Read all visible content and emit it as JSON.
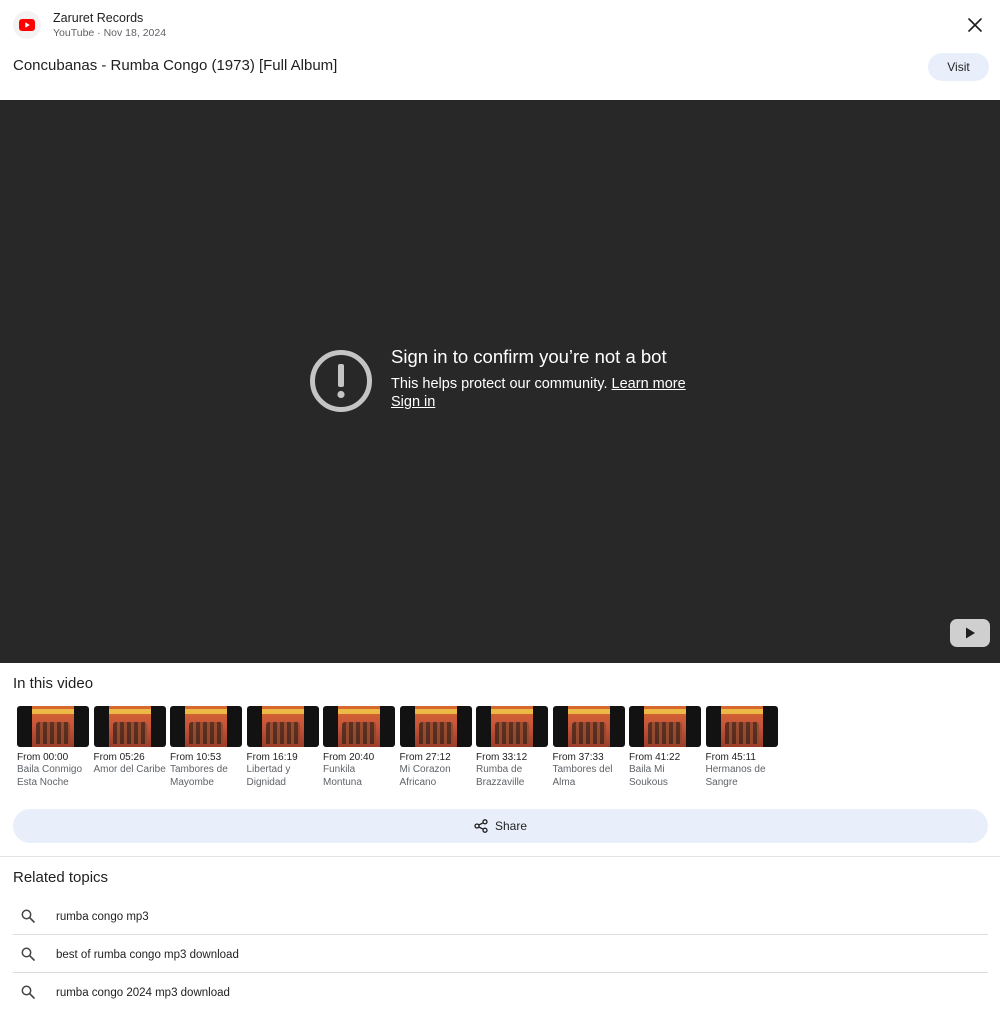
{
  "header": {
    "channel_name": "Zaruret Records",
    "channel_meta": "YouTube · Nov 18, 2024",
    "title": "Concubanas - Rumba Congo (1973) [Full Album]",
    "visit_label": "Visit",
    "icons": {
      "logo": "youtube-logo-icon",
      "close": "close-icon"
    }
  },
  "player": {
    "heading": "Sign in to confirm you’re not a bot",
    "body": "This helps protect our community.",
    "learn_more": "Learn more",
    "sign_in": "Sign in",
    "icons": {
      "warning": "exclamation-circle-icon",
      "play": "youtube-play-icon"
    }
  },
  "chapters": {
    "title": "In this video",
    "items": [
      {
        "time": "From 00:00",
        "name": "Baila Conmigo Esta Noche"
      },
      {
        "time": "From 05:26",
        "name": "Amor del Caribe"
      },
      {
        "time": "From 10:53",
        "name": "Tambores de Mayombe"
      },
      {
        "time": "From 16:19",
        "name": "Libertad y Dignidad"
      },
      {
        "time": "From 20:40",
        "name": "Funkila Montuna"
      },
      {
        "time": "From 27:12",
        "name": "Mi Corazon Africano"
      },
      {
        "time": "From 33:12",
        "name": "Rumba de Brazzaville"
      },
      {
        "time": "From 37:33",
        "name": "Tambores del Alma"
      },
      {
        "time": "From 41:22",
        "name": "Baila Mi Soukous"
      },
      {
        "time": "From 45:11",
        "name": "Hermanos de Sangre"
      }
    ]
  },
  "share": {
    "label": "Share",
    "icon": "share-icon"
  },
  "related": {
    "title": "Related topics",
    "items": [
      {
        "label": "rumba congo mp3"
      },
      {
        "label": "best of rumba congo mp3 download"
      },
      {
        "label": "rumba congo 2024 mp3 download"
      }
    ]
  }
}
